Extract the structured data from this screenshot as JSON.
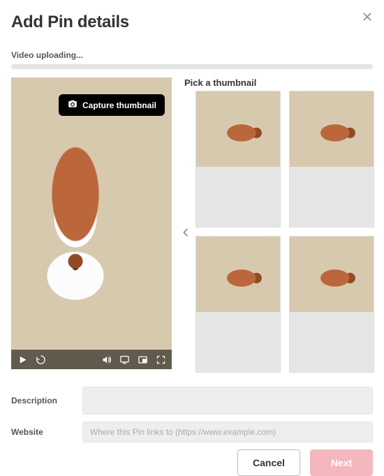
{
  "header": {
    "title": "Add Pin details",
    "close_icon": "close-icon"
  },
  "upload": {
    "status_label": "Video uploading..."
  },
  "preview": {
    "capture_label": "Capture thumbnail",
    "controls": {
      "play": "play-icon",
      "replay": "replay-icon",
      "volume": "volume-icon",
      "cast": "cast-icon",
      "pip": "pip-icon",
      "fullscreen": "fullscreen-icon"
    }
  },
  "thumbnails": {
    "heading": "Pick a thumbnail",
    "items": [
      {
        "id": "thumb-1"
      },
      {
        "id": "thumb-2"
      },
      {
        "id": "thumb-3"
      },
      {
        "id": "thumb-4"
      }
    ]
  },
  "form": {
    "description_label": "Description",
    "description_value": "",
    "website_label": "Website",
    "website_value": "",
    "website_placeholder": "Where this Pin links to (https://www.example.com)"
  },
  "footer": {
    "cancel_label": "Cancel",
    "next_label": "Next"
  }
}
